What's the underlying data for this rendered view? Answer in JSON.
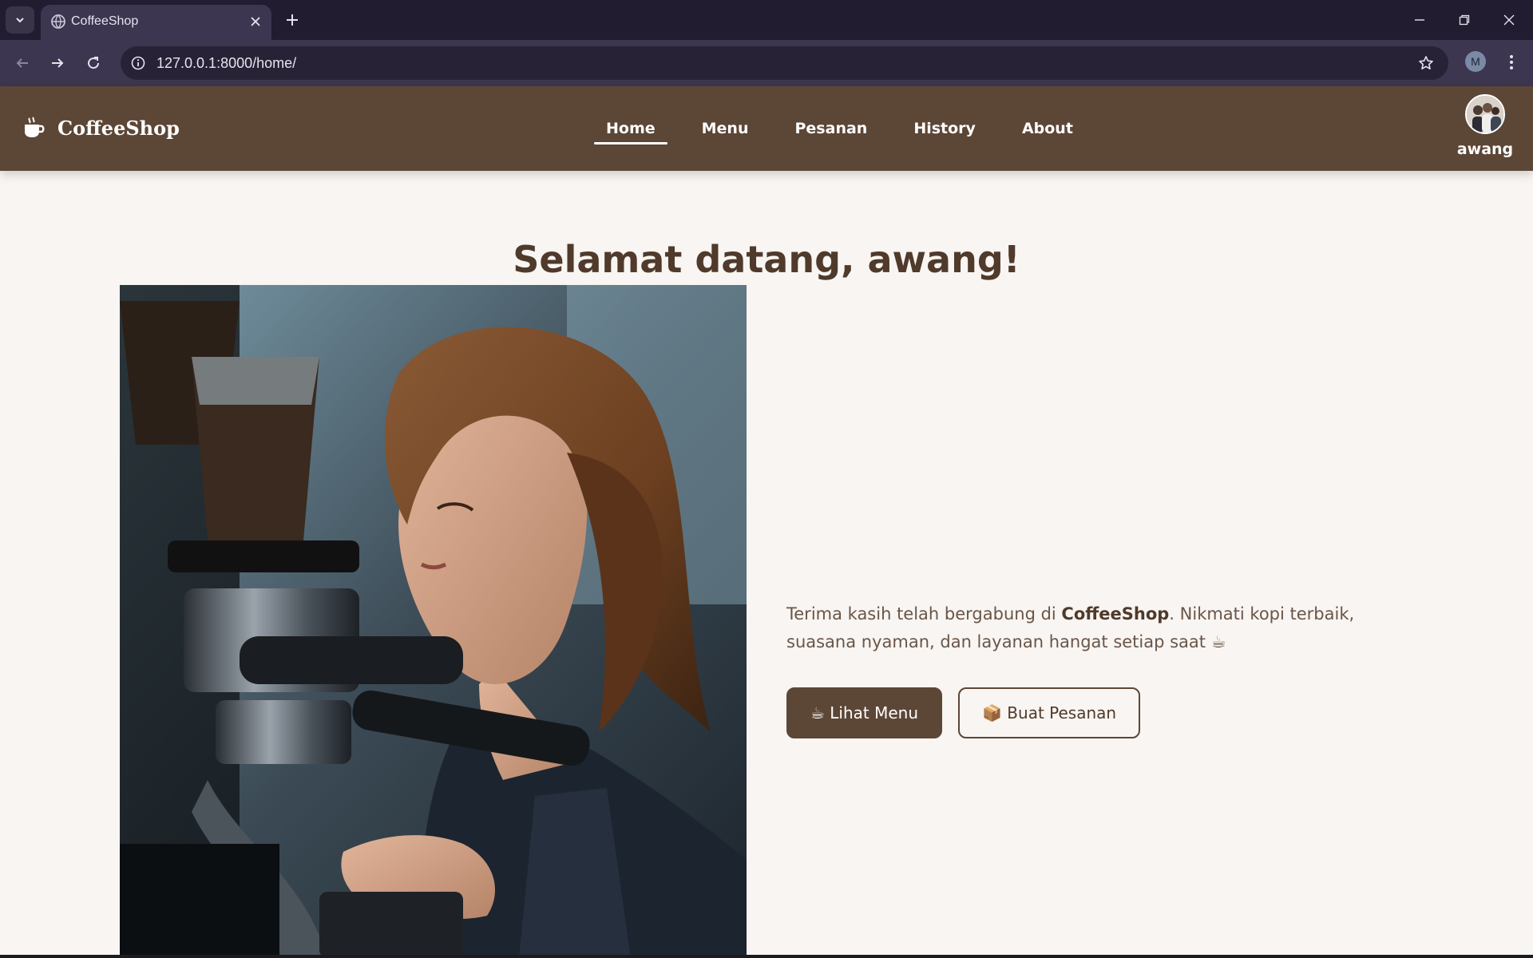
{
  "browser": {
    "tab_title": "CoffeeShop",
    "url": "127.0.0.1:8000/home/",
    "profile_initial": "M"
  },
  "navbar": {
    "brand": "CoffeeShop",
    "links": [
      {
        "label": "Home",
        "active": true
      },
      {
        "label": "Menu",
        "active": false
      },
      {
        "label": "Pesanan",
        "active": false
      },
      {
        "label": "History",
        "active": false
      },
      {
        "label": "About",
        "active": false
      }
    ],
    "username": "awang"
  },
  "hero": {
    "welcome": "Selamat datang, awang!",
    "text_before": "Terima kasih telah bergabung di ",
    "text_brand": "CoffeeShop",
    "text_after": ". Nikmati kopi terbaik, suasana nyaman, dan layanan hangat setiap saat ☕",
    "photo_icon": "barista-photo",
    "primary_button": "☕ Lihat Menu",
    "secondary_button": "📦 Buat Pesanan"
  },
  "colors": {
    "nav_bg": "#5c4636",
    "page_bg": "#f8f5f2",
    "heading": "#4f3a2b",
    "body_text": "#6a5548"
  }
}
